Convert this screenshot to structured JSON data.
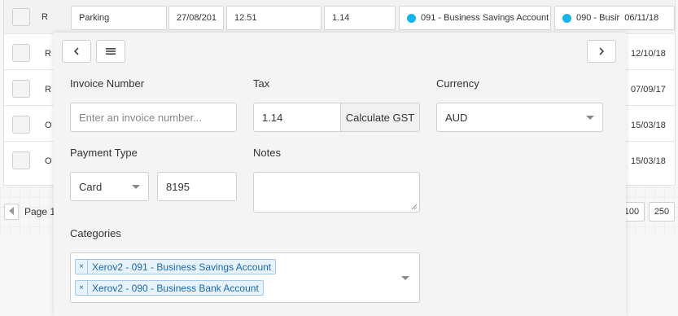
{
  "table": {
    "rows": [
      {
        "letter": "R",
        "date": ""
      },
      {
        "letter": "R",
        "date": "12/10/18"
      },
      {
        "letter": "R",
        "date": "07/09/17"
      },
      {
        "letter": "O",
        "date": "15/03/18"
      },
      {
        "letter": "O",
        "date": "15/03/18"
      }
    ],
    "first_row_cells": {
      "description": "Parking",
      "date": "27/08/201",
      "amount": "12.51",
      "tax": "1.14",
      "account1": "091 - Business Savings Account",
      "account2": "090 - Busir",
      "account2_date": "06/11/18"
    }
  },
  "pager": {
    "page_label": "Page 1",
    "size_100": "100",
    "size_250": "250"
  },
  "panel": {
    "back_icon": "chevron-left-icon",
    "menu_icon": "hamburger-icon",
    "next_icon": "chevron-right-icon",
    "invoice_number": {
      "label": "Invoice Number",
      "placeholder": "Enter an invoice number..."
    },
    "tax": {
      "label": "Tax",
      "value": "1.14",
      "button": "Calculate GST"
    },
    "currency": {
      "label": "Currency",
      "value": "AUD"
    },
    "payment_type": {
      "label": "Payment Type",
      "value": "Card",
      "card_number": "8195"
    },
    "notes": {
      "label": "Notes",
      "value": ""
    },
    "categories": {
      "label": "Categories",
      "tags": [
        "Xerov2 - 091 - Business Savings Account",
        "Xerov2 - 090 - Business Bank Account"
      ]
    }
  },
  "colors": {
    "xero_blue": "#13b5ea",
    "tag_text": "#1769b3",
    "tag_bg": "#e8f2fb"
  }
}
